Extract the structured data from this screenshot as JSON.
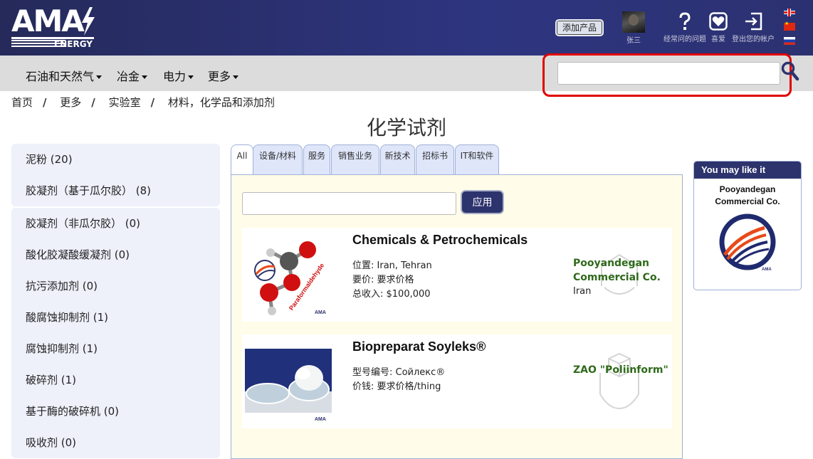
{
  "header": {
    "logo_text": "AMA",
    "logo_sub": "ENERGY",
    "add_product": "添加产品",
    "user_name": "张三",
    "icons": [
      {
        "name": "question-icon",
        "label": "经常问的问题"
      },
      {
        "name": "heart-icon",
        "label": "喜爱"
      },
      {
        "name": "logout-icon",
        "label": "登出您的帐户"
      }
    ],
    "flags": [
      "uk-flag",
      "china-flag",
      "russia-flag"
    ]
  },
  "nav": {
    "items": [
      "石油和天然气",
      "冶金",
      "电力",
      "更多"
    ],
    "search_placeholder": ""
  },
  "breadcrumb": [
    "首页",
    "更多",
    "实验室",
    "材料，化学品和添加剂"
  ],
  "page_title": "化学试剂",
  "sidebar": {
    "group1": [
      "泥粉 (20)",
      "胶凝剂（基于瓜尔胶） (8)"
    ],
    "group2": [
      "胶凝剂（非瓜尔胶） (0)",
      "酸化胶凝酸缓凝剂 (0)",
      "抗污添加剂 (0)",
      "酸腐蚀抑制剂 (1)",
      "腐蚀抑制剂 (1)",
      "破碎剂 (1)",
      "基于酶的破碎机 (0)",
      "吸收剂 (0)"
    ]
  },
  "tabs": [
    "All",
    "设备/材料",
    "服务",
    "销售业务",
    "新技术",
    "招标书",
    "IT和软件"
  ],
  "filter": {
    "placeholder": "",
    "apply_label": "应用"
  },
  "listings": [
    {
      "title": "Chemicals & Petrochemicals",
      "lines": [
        "位置: Iran, Tehran",
        "要价: 要求价格",
        "总收入: $100,000"
      ],
      "company": [
        "Pooyandegan",
        "Commercial Co."
      ],
      "country": "Iran",
      "image_caption": "Paraformaldehyde",
      "watermark": "AMA"
    },
    {
      "title": "Biopreparat Soyleks®",
      "lines": [
        "型号编号: Сойлекс®",
        "价钱: 要求价格/thing"
      ],
      "company": [
        "ZAO \"Poliinform\""
      ],
      "country": "",
      "watermark": "AMA"
    }
  ],
  "ad": {
    "heading": "You may like it",
    "company_line1": "Pooyandegan",
    "company_line2": "Commercial Co.",
    "logo_text": "AMA"
  },
  "colors": {
    "header_bg": "#2b3170",
    "nav_bg": "#dcdcdc",
    "highlight_border": "#e10000",
    "company_green": "#2f6a1a",
    "sidebar_bg": "#eef0fa",
    "panel_bg": "#fffde9"
  }
}
